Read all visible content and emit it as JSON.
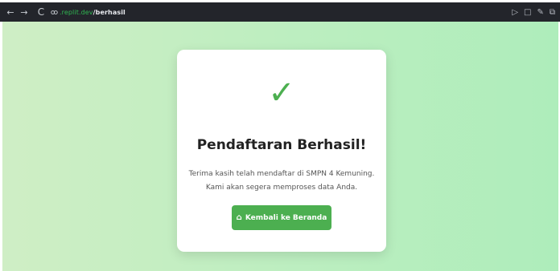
{
  "browser": {
    "back_icon": "←",
    "forward_icon": "→",
    "reload_icon": "C",
    "url_host": ".replit.dev",
    "url_path": "/berhasil",
    "icons": [
      "send-to-device-icon",
      "pen-icon",
      "extensions-icon"
    ]
  },
  "page": {
    "check_glyph": "✓",
    "title": "Pendaftaran Berhasil!",
    "message_line1": "Terima kasih telah mendaftar di SMPN 4 Kemuning.",
    "message_line2": "Kami akan segera memproses data Anda.",
    "button_icon": "⌂",
    "button_label": "Kembali ke Beranda"
  },
  "colors": {
    "accent": "#4caf50",
    "background_left": "#cfeec5",
    "background_right": "#aeedbb",
    "browser_bar": "#23252b"
  }
}
